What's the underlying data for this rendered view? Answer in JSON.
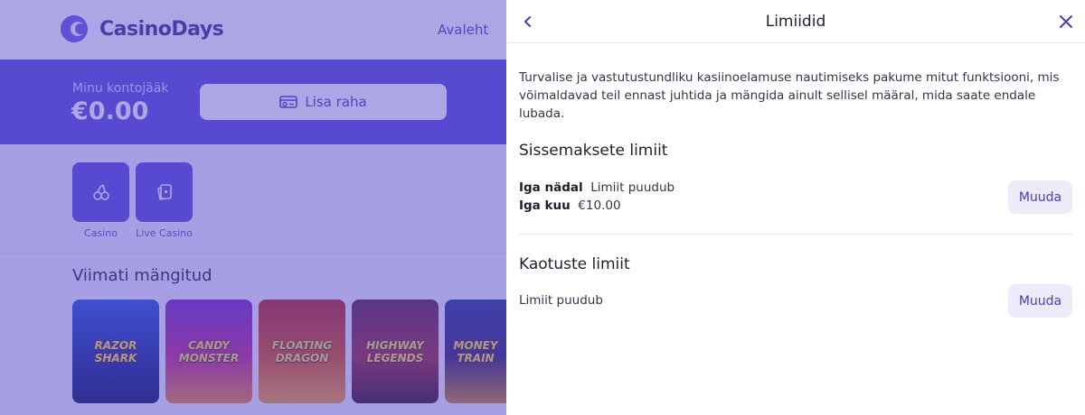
{
  "site": {
    "logo_text": "CasinoDays",
    "nav_home": "Avaleht",
    "balance_label": "Minu kontojääk",
    "balance_value": "€0.00",
    "deposit_label": "Lisa raha",
    "categories": [
      {
        "label": "Casino",
        "icon": "cherries-icon"
      },
      {
        "label": "Live Casino",
        "icon": "cards-icon"
      }
    ],
    "recent_title": "Viimati mängitud",
    "games": [
      {
        "title": "RAZOR SHARK"
      },
      {
        "title": "CANDY MONSTER"
      },
      {
        "title": "FLOATING DRAGON"
      },
      {
        "title": "HIGHWAY LEGENDS"
      },
      {
        "title": "MONEY TRAIN"
      }
    ]
  },
  "drawer": {
    "title": "Limiidid",
    "intro": "Turvalise ja vastutustundliku kasiinoelamuse nautimiseks pakume mitut funktsiooni, mis võimaldavad teil ennast juhtida ja mängida ainult sellisel määral, mida saate endale lubada.",
    "deposit_limits": {
      "title": "Sissemaksete limiit",
      "weekly_label": "Iga nädal",
      "weekly_value": "Limiit puudub",
      "monthly_label": "Iga kuu",
      "monthly_value": "€10.00",
      "change_label": "Muuda"
    },
    "loss_limits": {
      "title": "Kaotuste limiit",
      "value": "Limiit puudub",
      "change_label": "Muuda"
    }
  },
  "colors": {
    "brand": "#5a4fd6",
    "accent_text": "#4a3fb8",
    "button_bg": "#edeafa"
  }
}
